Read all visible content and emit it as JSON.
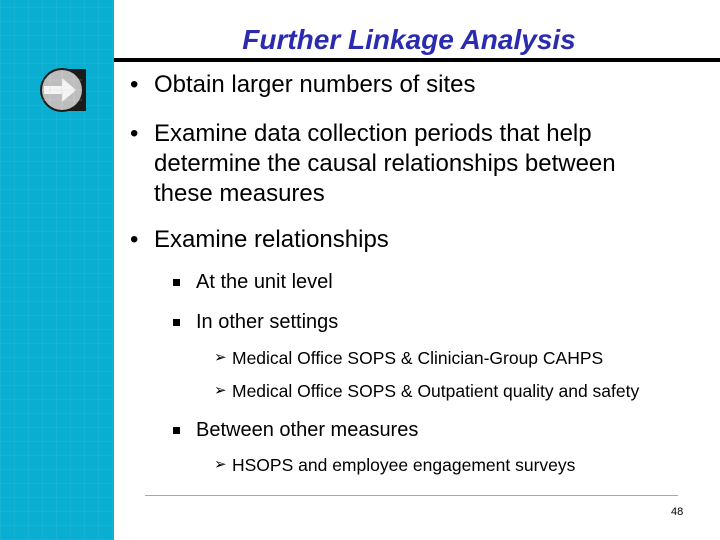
{
  "slide": {
    "title": "Further Linkage Analysis",
    "bullets": [
      {
        "text": "Obtain larger numbers of sites"
      },
      {
        "text_lines": [
          "Examine data collection periods that help",
          "determine the causal relationships between",
          "these measures"
        ]
      },
      {
        "text": "Examine relationships"
      }
    ],
    "sub_bullets": [
      {
        "text": "At the unit level"
      },
      {
        "text": "In other settings"
      },
      {
        "text": "Between other measures"
      }
    ],
    "sub_sub_bullets": [
      {
        "text": "Medical Office SOPS & Clinician-Group CAHPS"
      },
      {
        "text": "Medical Office SOPS & Outpatient quality and safety"
      },
      {
        "text": "HSOPS and employee engagement surveys"
      }
    ],
    "bullet_glyph": "•",
    "arrow_glyph": "➢",
    "page_number": "48",
    "logo_icon": "arrow-circle-icon",
    "colors": {
      "sidebar": "#0aaed0",
      "title": "#2b2bb0",
      "rule": "#000000",
      "footer_rule": "#7fb6c9"
    }
  }
}
